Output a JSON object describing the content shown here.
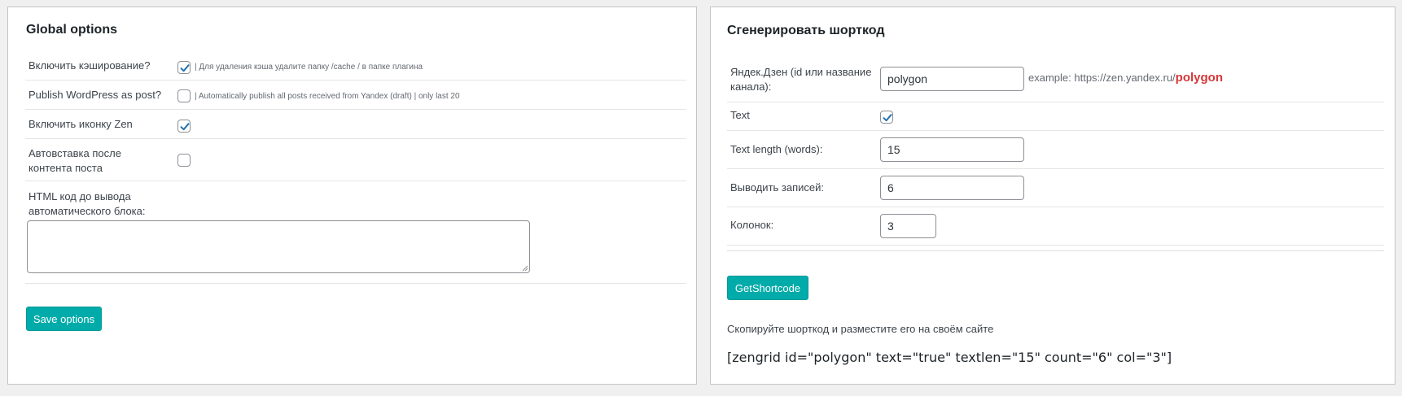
{
  "global_options": {
    "title": "Global options",
    "rows": [
      {
        "label": "Включить кэширование?",
        "checked": true,
        "hint": "| Для удаления кэша удалите папку /cache / в папке плагина"
      },
      {
        "label": "Publish WordPress as post?",
        "checked": false,
        "hint": "| Automatically publish all posts received from Yandex (draft) | only last 20"
      },
      {
        "label": "Включить иконку Zen",
        "checked": true,
        "hint": ""
      },
      {
        "label": "Автовставка после контента поста",
        "checked": false,
        "hint": ""
      },
      {
        "label": "HTML код до вывода автоматического блока:",
        "value": ""
      }
    ],
    "save_label": "Save options"
  },
  "shortcode_generator": {
    "title": "Сгенерировать шорткод",
    "channel": {
      "label": "Яндек.Дзен (id или название канала):",
      "value": "polygon",
      "example_prefix": "example: https://zen.yandex.ru/",
      "example_accent": "polygon"
    },
    "text": {
      "label": "Text",
      "checked": true
    },
    "text_length": {
      "label": "Text length (words):",
      "value": "15"
    },
    "records": {
      "label": "Выводить записей:",
      "value": "6"
    },
    "columns": {
      "label": "Колонок:",
      "value": "3"
    },
    "button_label": "GetShortcode",
    "copy_hint": "Скопируйте шорткод и разместите его на своём сайте",
    "output": "[zengrid id=\"polygon\" text=\"true\" textlen=\"15\" count=\"6\" col=\"3\"]"
  },
  "colors": {
    "accent_button": "#00aba9",
    "example_accent": "#d63638",
    "checkmark": "#2271b1"
  }
}
